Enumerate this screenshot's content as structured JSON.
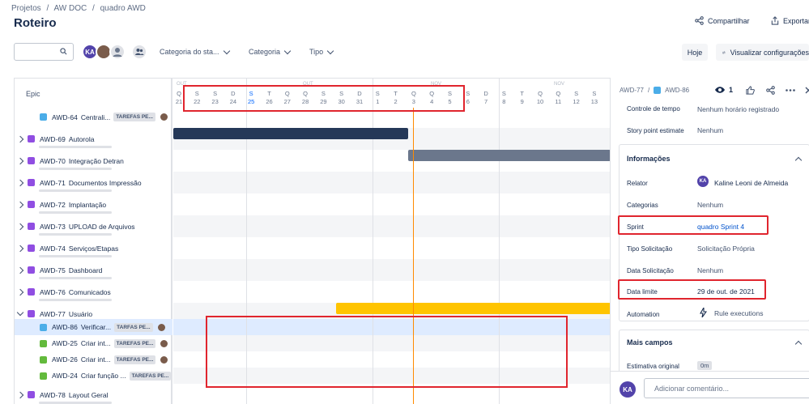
{
  "breadcrumb": [
    "Projetos",
    "/",
    "AW DOC",
    "/",
    "quadro AWD"
  ],
  "page_title": "Roteiro",
  "header_actions": {
    "share": "Compartilhar",
    "export": "Exportar"
  },
  "toolbar": {
    "avatar_initials": "KA",
    "filters": [
      "Categoria do sta...",
      "Categoria",
      "Tipo"
    ],
    "today_button": "Hoje",
    "view_settings": "Visualizar configurações"
  },
  "gantt": {
    "epic_header": "Epic",
    "months": [
      "OUT",
      "NOV"
    ],
    "day_letters": [
      "Q",
      "S",
      "S",
      "D",
      "S",
      "T",
      "Q",
      "Q",
      "S",
      "S",
      "D",
      "S",
      "T",
      "Q",
      "Q",
      "S",
      "S",
      "D",
      "S",
      "T",
      "Q",
      "Q",
      "S",
      "S"
    ],
    "day_numbers": [
      "21",
      "22",
      "23",
      "24",
      "25",
      "26",
      "27",
      "28",
      "29",
      "30",
      "31",
      "1",
      "2",
      "3",
      "4",
      "5",
      "6",
      "7",
      "8",
      "9",
      "10",
      "11",
      "12",
      "13"
    ],
    "rows": [
      {
        "type": "task",
        "key": "AWD-64",
        "name": "Centrali...",
        "badge": "TAREFAS PE...",
        "child": true
      },
      {
        "type": "epic",
        "key": "AWD-69",
        "name": "Autorola"
      },
      {
        "type": "epic",
        "key": "AWD-70",
        "name": "Integração Detran"
      },
      {
        "type": "epic",
        "key": "AWD-71",
        "name": "Documentos Impressão"
      },
      {
        "type": "epic",
        "key": "AWD-72",
        "name": "Implantação"
      },
      {
        "type": "epic",
        "key": "AWD-73",
        "name": "UPLOAD de Arquivos"
      },
      {
        "type": "epic",
        "key": "AWD-74",
        "name": "Serviços/Etapas"
      },
      {
        "type": "epic",
        "key": "AWD-75",
        "name": "Dashboard"
      },
      {
        "type": "epic",
        "key": "AWD-76",
        "name": "Comunicados"
      },
      {
        "type": "epic",
        "key": "AWD-77",
        "name": "Usuário",
        "open": true
      },
      {
        "type": "task",
        "key": "AWD-86",
        "name": "Verificar...",
        "badge": "TARFAS PE...",
        "child": true,
        "selected": true
      },
      {
        "type": "story",
        "key": "AWD-25",
        "name": "Criar int...",
        "badge": "TAREFAS PE...",
        "child": true
      },
      {
        "type": "story",
        "key": "AWD-26",
        "name": "Criar int...",
        "badge": "TAREFAS PE...",
        "child": true
      },
      {
        "type": "story",
        "key": "AWD-24",
        "name": "Criar função ...",
        "badge": "TAREFAS PE...",
        "child": true
      },
      {
        "type": "epic",
        "key": "AWD-78",
        "name": "Layout Geral"
      }
    ],
    "colors": {
      "dark_bar": "#253858",
      "gray_bar": "#6b778c",
      "yellow_bar": "#ffc400",
      "today": "#ff8b00",
      "highlight": "#e0252e"
    }
  },
  "panel": {
    "breadcrumb_parent": "AWD-77",
    "breadcrumb_sep": "/",
    "breadcrumb_issue": "AWD-86",
    "watchers": "1",
    "fields_top": [
      {
        "label": "Controle de tempo",
        "value": "Nenhum horário registrado"
      },
      {
        "label": "Story point estimate",
        "value": "Nenhum"
      }
    ],
    "info_title": "Informações",
    "fields_info": [
      {
        "label": "Relator",
        "value": "Kaline Leoni de Almeida"
      },
      {
        "label": "Categorias",
        "value": "Nenhum"
      },
      {
        "label": "Sprint",
        "value": "quadro Sprint 4"
      },
      {
        "label": "Tipo Solicitação",
        "value": "Solicitação Própria"
      },
      {
        "label": "Data Solicitação",
        "value": "Nenhum"
      },
      {
        "label": "Data limite",
        "value": "29 de out. de 2021"
      },
      {
        "label": "Automation",
        "value": "Rule executions"
      }
    ],
    "more_title": "Mais campos",
    "estimate_label": "Estimativa original",
    "estimate_value": "0m",
    "comment_placeholder": "Adicionar comentário..."
  }
}
